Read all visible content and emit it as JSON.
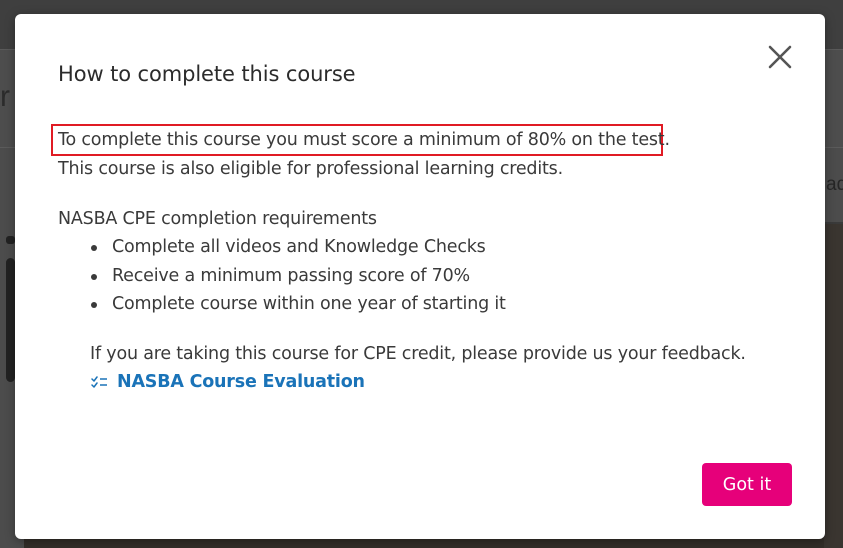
{
  "dialog": {
    "title": "How to complete this course",
    "close_icon": "close-icon",
    "highlighted_requirement": "To complete this course you must score a minimum of 80% on the test.",
    "eligibility_note": "This course is also eligible for professional learning credits.",
    "nasba": {
      "heading": "NASBA CPE completion requirements",
      "requirements": [
        "Complete all videos and Knowledge Checks",
        "Receive a minimum passing score of 70%",
        "Complete course within one year of starting it"
      ],
      "feedback_prompt": "If you are taking this course for CPE credit, please provide us your feedback.",
      "evaluation_link": {
        "icon": "checklist-icon",
        "label": "NASBA Course Evaluation"
      }
    },
    "confirm_button": "Got it"
  },
  "colors": {
    "accent": "#e6007a",
    "link": "#1a73b8",
    "highlight_border": "#e01b24"
  }
}
